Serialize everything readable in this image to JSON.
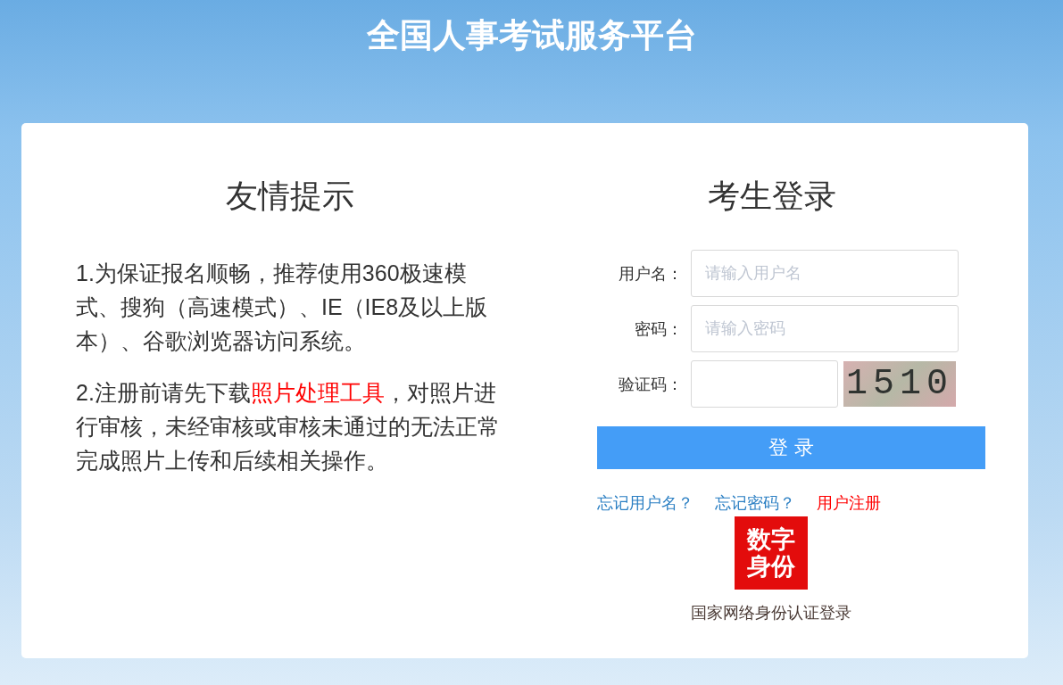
{
  "header": {
    "title": "全国人事考试服务平台"
  },
  "notice": {
    "heading": "友情提示",
    "paragraphs": [
      {
        "kind": "plain",
        "text": "1.为保证报名顺畅，推荐使用360极速模式、搜狗（高速模式）、IE（IE8及以上版本）、谷歌浏览器访问系统。"
      },
      {
        "kind": "link",
        "before": "2.注册前请先下载",
        "link": "照片处理工具",
        "after": "，对照片进行审核，未经审核或审核未通过的无法正常完成照片上传和后续相关操作。"
      }
    ]
  },
  "login": {
    "heading": "考生登录",
    "fields": [
      {
        "kind": "text",
        "label": "用户名：",
        "placeholder": "请输入用户名"
      },
      {
        "kind": "password",
        "label": "密码：",
        "placeholder": "请输入密码"
      },
      {
        "kind": "captcha",
        "label": "验证码：",
        "captcha": "1510"
      }
    ],
    "submit": "登 录",
    "links": [
      {
        "label": "忘记用户名？",
        "color": "#2b7fc3"
      },
      {
        "label": "忘记密码？",
        "color": "#2b7fc3"
      },
      {
        "label": "用户注册",
        "color": "#ff0000"
      }
    ],
    "badge": "数字身份",
    "badge_caption": "国家网络身份认证登录"
  }
}
